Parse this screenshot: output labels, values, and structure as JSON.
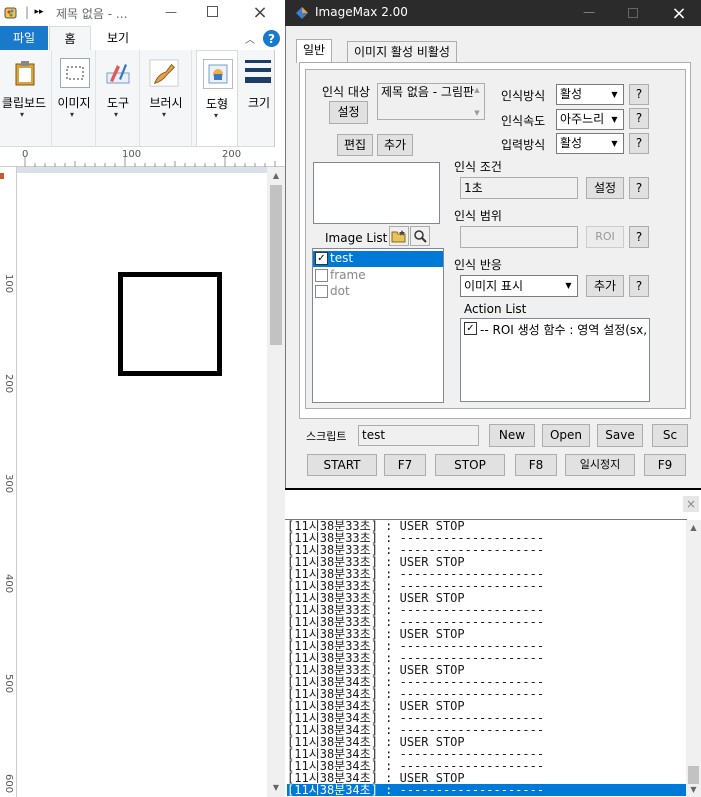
{
  "paint": {
    "title": "제목 없음 - ...",
    "title_prefix": "|",
    "tabs": {
      "file": "파일",
      "home": "홈",
      "view": "보기"
    },
    "help": "?",
    "ribbon": {
      "clipboard": "클립보드",
      "image": "이미지",
      "tools": "도구",
      "brushes": "브러시",
      "shapes": "도형",
      "size": "크기"
    },
    "hruler": [
      "0",
      "100",
      "200"
    ],
    "vruler": [
      "100",
      "200",
      "300",
      "400",
      "500",
      "600"
    ],
    "colors": {
      "accent": "#1979ca"
    }
  },
  "imagemax": {
    "title": "ImageMax 2.00",
    "tabs": {
      "general": "일반",
      "activation": "이미지 활성 비활성"
    },
    "target": {
      "label": "인식 대상",
      "value": "제목 없음 - 그림판",
      "set_button": "설정"
    },
    "edit_button": "편집",
    "add_button": "추가",
    "method": {
      "label": "인식방식",
      "value": "활성"
    },
    "speed": {
      "label": "인식속도",
      "value": "아주느리"
    },
    "input": {
      "label": "입력방식",
      "value": "활성"
    },
    "help": "?",
    "condition": {
      "label": "인식 조건",
      "value": "1초",
      "button": "설정"
    },
    "range": {
      "label": "인식 범위",
      "value": "",
      "button": "ROI"
    },
    "reaction": {
      "label": "인식 반응",
      "value": "이미지 표시",
      "button": "추가"
    },
    "action_list": {
      "label": "Action List",
      "items": [
        {
          "text": "-- ROI 생성 함수 : 영역 설정(sx,",
          "checked": true
        }
      ]
    },
    "image_list": {
      "label": "Image List",
      "items": [
        {
          "name": "test",
          "checked": true,
          "selected": true
        },
        {
          "name": "frame",
          "checked": false,
          "selected": false
        },
        {
          "name": "dot",
          "checked": false,
          "selected": false
        }
      ]
    },
    "script": {
      "label": "스크립트",
      "value": "test",
      "new": "New",
      "open": "Open",
      "save": "Save",
      "sc": "Sc"
    },
    "controls": {
      "start": "START",
      "start_key": "F7",
      "stop": "STOP",
      "stop_key": "F8",
      "pause": "일시정지",
      "pause_key": "F9"
    },
    "colors": {
      "title_bg": "#2b2b2b",
      "selection": "#0078d7"
    }
  },
  "log": {
    "close": "×",
    "rows": [
      {
        "text": "[11시38분33초] :     USER STOP",
        "selected": false
      },
      {
        "text": "[11시38분33초] : --------------------",
        "selected": false
      },
      {
        "text": "[11시38분33초] : --------------------",
        "selected": false
      },
      {
        "text": "[11시38분33초] :     USER STOP",
        "selected": false
      },
      {
        "text": "[11시38분33초] : --------------------",
        "selected": false
      },
      {
        "text": "[11시38분33초] : --------------------",
        "selected": false
      },
      {
        "text": "[11시38분33초] :     USER STOP",
        "selected": false
      },
      {
        "text": "[11시38분33초] : --------------------",
        "selected": false
      },
      {
        "text": "[11시38분33초] : --------------------",
        "selected": false
      },
      {
        "text": "[11시38분33초] :     USER STOP",
        "selected": false
      },
      {
        "text": "[11시38분33초] : --------------------",
        "selected": false
      },
      {
        "text": "[11시38분33초] : --------------------",
        "selected": false
      },
      {
        "text": "[11시38분33초] :     USER STOP",
        "selected": false
      },
      {
        "text": "[11시38분34초] : --------------------",
        "selected": false
      },
      {
        "text": "[11시38분34초] : --------------------",
        "selected": false
      },
      {
        "text": "[11시38분34초] :     USER STOP",
        "selected": false
      },
      {
        "text": "[11시38분34초] : --------------------",
        "selected": false
      },
      {
        "text": "[11시38분34초] : --------------------",
        "selected": false
      },
      {
        "text": "[11시38분34초] :     USER STOP",
        "selected": false
      },
      {
        "text": "[11시38분34초] : --------------------",
        "selected": false
      },
      {
        "text": "[11시38분34초] : --------------------",
        "selected": false
      },
      {
        "text": "[11시38분34초] :     USER STOP",
        "selected": false
      },
      {
        "text": "[11시38분34초] : --------------------",
        "selected": true
      }
    ]
  }
}
